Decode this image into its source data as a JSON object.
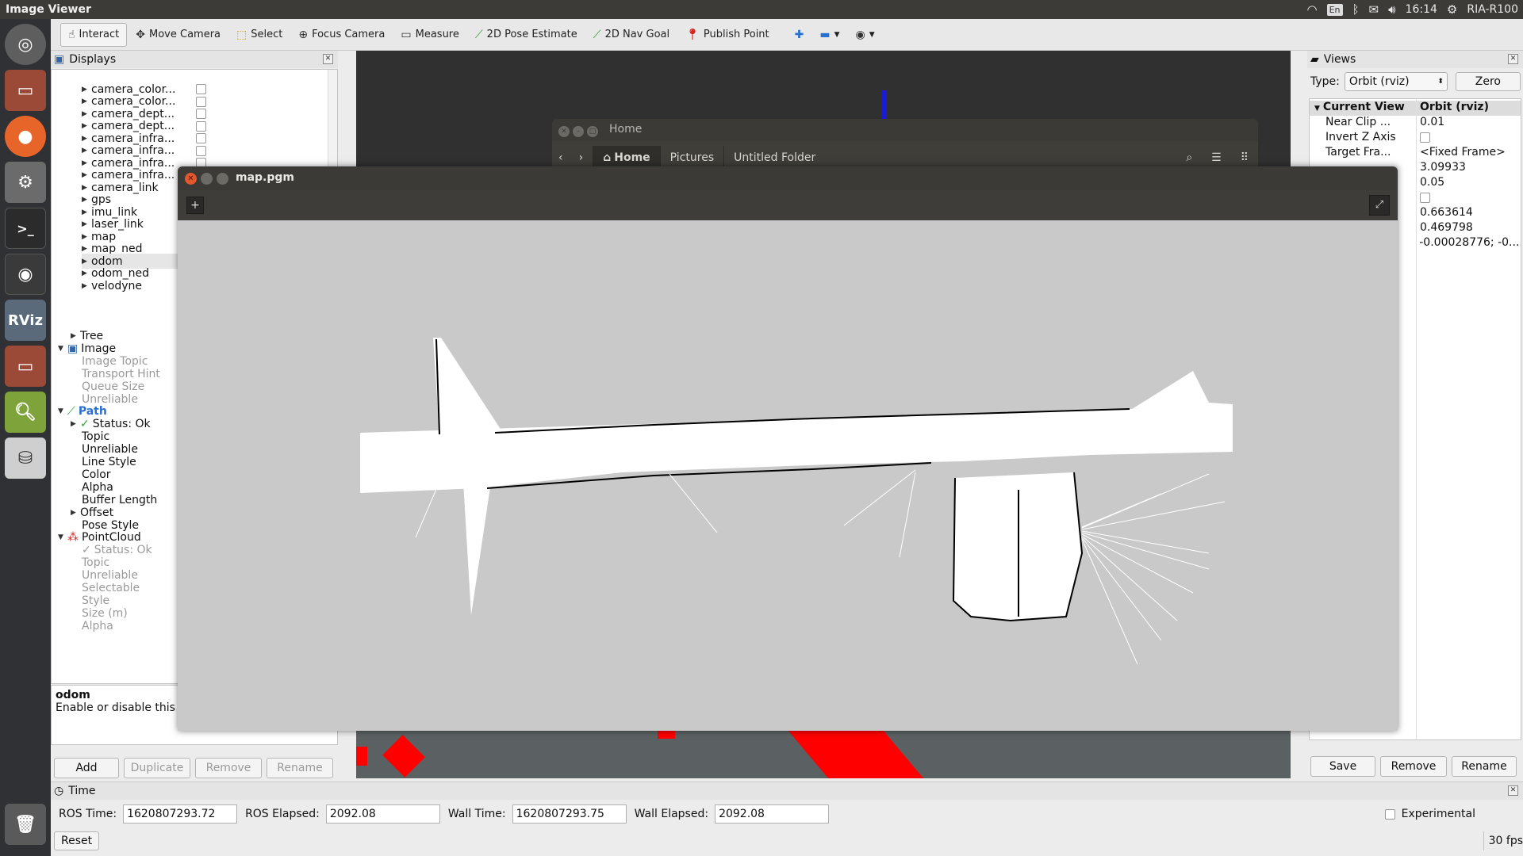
{
  "top_panel": {
    "title": "Image Viewer",
    "lang": "En",
    "time": "16:14",
    "user": "RIA-R100"
  },
  "launcher": {
    "items": [
      "ubuntu-dash",
      "files",
      "firefox",
      "system-settings",
      "terminal",
      "camera",
      "rviz",
      "files-2",
      "image-viewer",
      "disk"
    ]
  },
  "toolbar": {
    "tools": [
      {
        "label": "Interact",
        "icon": "hand-icon"
      },
      {
        "label": "Move Camera",
        "icon": "move-icon"
      },
      {
        "label": "Select",
        "icon": "select-icon"
      },
      {
        "label": "Focus Camera",
        "icon": "focus-icon"
      },
      {
        "label": "Measure",
        "icon": "ruler-icon"
      },
      {
        "label": "2D Pose Estimate",
        "icon": "arrow-green-icon"
      },
      {
        "label": "2D Nav Goal",
        "icon": "arrow-green-icon"
      },
      {
        "label": "Publish Point",
        "icon": "pin-icon"
      }
    ]
  },
  "displays": {
    "title": "Displays",
    "rows": [
      "camera_color...",
      "camera_color...",
      "camera_dept...",
      "camera_dept...",
      "camera_infra...",
      "camera_infra...",
      "camera_infra...",
      "camera_infra...",
      "camera_link",
      "gps",
      "imu_link",
      "laser_link",
      "map",
      "map_ned",
      "odom",
      "odom_ned",
      "velodyne"
    ],
    "tree_label": "Tree",
    "image": {
      "label": "Image",
      "props": [
        "Image Topic",
        "Transport Hint",
        "Queue Size",
        "Unreliable"
      ]
    },
    "path": {
      "label": "Path",
      "status": "Status: Ok",
      "props": [
        "Topic",
        "Unreliable",
        "Line Style",
        "Color",
        "Alpha",
        "Buffer Length"
      ],
      "offset": "Offset",
      "pose_style": "Pose Style"
    },
    "pointcloud": {
      "label": "PointCloud",
      "status": "Status: Ok",
      "props": [
        "Topic",
        "Unreliable",
        "Selectable",
        "Style",
        "Size (m)",
        "Alpha"
      ]
    },
    "desc_title": "odom",
    "desc_text": "Enable or disable this i",
    "buttons": {
      "add": "Add",
      "duplicate": "Duplicate",
      "remove": "Remove",
      "rename": "Rename"
    }
  },
  "views": {
    "title": "Views",
    "type_label": "Type:",
    "type_value": "Orbit (rviz)",
    "zero": "Zero",
    "header": {
      "k": "Current View",
      "v": "Orbit (rviz)"
    },
    "rows": [
      {
        "k": "Near Clip ...",
        "v": "0.01"
      },
      {
        "k": "Invert Z Axis",
        "v": ""
      },
      {
        "k": "Target Fra...",
        "v": "<Fixed Frame>"
      },
      {
        "k": "",
        "v": "3.09933"
      },
      {
        "k": "",
        "v": "0.05"
      },
      {
        "k": "",
        "v": ""
      },
      {
        "k": "",
        "v": "0.663614"
      },
      {
        "k": "",
        "v": "0.469798"
      },
      {
        "k": "",
        "v": "-0.00028776; -0...."
      }
    ],
    "buttons": {
      "save": "Save",
      "remove": "Remove",
      "rename": "Rename"
    }
  },
  "time": {
    "title": "Time",
    "ros_time_label": "ROS Time:",
    "ros_time": "1620807293.72",
    "ros_elapsed_label": "ROS Elapsed:",
    "ros_elapsed": "2092.08",
    "wall_time_label": "Wall Time:",
    "wall_time": "1620807293.75",
    "wall_elapsed_label": "Wall Elapsed:",
    "wall_elapsed": "2092.08",
    "experimental": "Experimental",
    "reset": "Reset",
    "fps": "30 fps"
  },
  "nautilus": {
    "title": "Home",
    "crumbs": [
      "Home",
      "Pictures",
      "Untitled Folder"
    ]
  },
  "image_viewer": {
    "title": "map.pgm"
  }
}
